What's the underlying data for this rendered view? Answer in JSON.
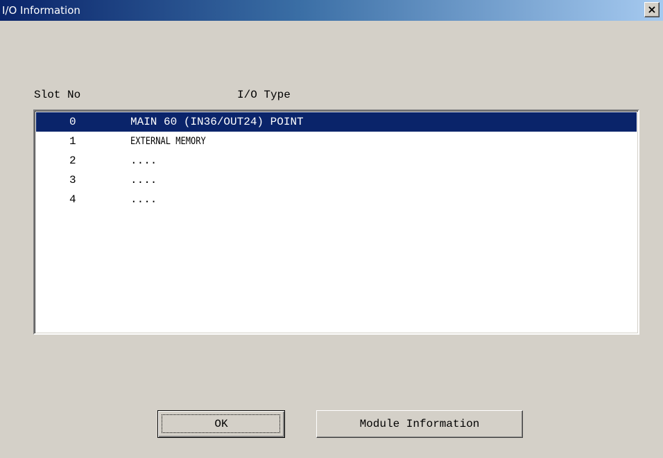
{
  "window": {
    "title": "I/O Information",
    "close_label": "×"
  },
  "table": {
    "headers": {
      "slot": "Slot No",
      "type": "I/O Type"
    },
    "rows": [
      {
        "slot": "0",
        "type": "MAIN 60 (IN36/OUT24) POINT",
        "selected": true
      },
      {
        "slot": "1",
        "type": "EXTERNAL MEMORY",
        "selected": false
      },
      {
        "slot": "2",
        "type": "....",
        "selected": false
      },
      {
        "slot": "3",
        "type": "....",
        "selected": false
      },
      {
        "slot": "4",
        "type": "....",
        "selected": false
      }
    ]
  },
  "buttons": {
    "ok": "OK",
    "module_info": "Module Information"
  },
  "colors": {
    "selection": "#0a246a",
    "dialog_face": "#d4d0c8"
  }
}
